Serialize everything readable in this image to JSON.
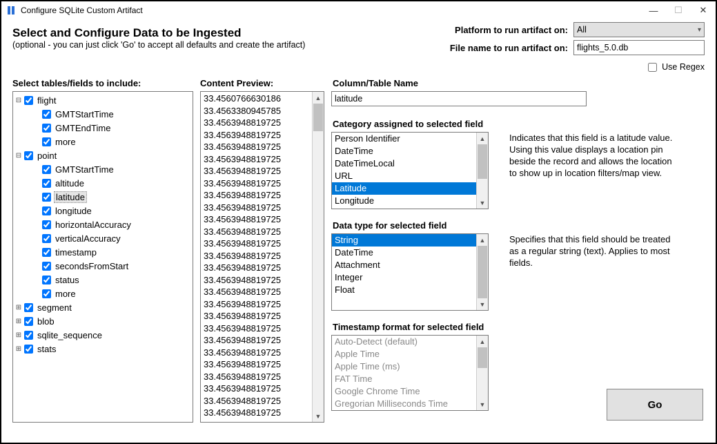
{
  "window": {
    "title": "Configure SQLite Custom Artifact"
  },
  "header": {
    "title": "Select and Configure Data to be Ingested",
    "subtitle": "(optional - you can just click 'Go' to accept all defaults and create the artifact)",
    "platform_label": "Platform to run artifact on:",
    "filename_label": "File name to run artifact on:",
    "platform_value": "All",
    "filename_value": "flights_5.0.db",
    "use_regex_label": "Use Regex"
  },
  "labels": {
    "tree": "Select tables/fields to include:",
    "preview": "Content Preview:",
    "column_name": "Column/Table Name",
    "category": "Category assigned to selected field",
    "datatype": "Data type for selected field",
    "timestamp": "Timestamp format for selected field",
    "go": "Go"
  },
  "column_name_value": "latitude",
  "tree": [
    {
      "toggle": "⊟",
      "indent": 0,
      "label": "flight"
    },
    {
      "toggle": "",
      "indent": 1,
      "label": "GMTStartTime"
    },
    {
      "toggle": "",
      "indent": 1,
      "label": "GMTEndTime"
    },
    {
      "toggle": "",
      "indent": 1,
      "label": "more"
    },
    {
      "toggle": "⊟",
      "indent": 0,
      "label": "point"
    },
    {
      "toggle": "",
      "indent": 1,
      "label": "GMTStartTime"
    },
    {
      "toggle": "",
      "indent": 1,
      "label": "altitude"
    },
    {
      "toggle": "",
      "indent": 1,
      "label": "latitude",
      "selected": true
    },
    {
      "toggle": "",
      "indent": 1,
      "label": "longitude"
    },
    {
      "toggle": "",
      "indent": 1,
      "label": "horizontalAccuracy"
    },
    {
      "toggle": "",
      "indent": 1,
      "label": "verticalAccuracy"
    },
    {
      "toggle": "",
      "indent": 1,
      "label": "timestamp"
    },
    {
      "toggle": "",
      "indent": 1,
      "label": "secondsFromStart"
    },
    {
      "toggle": "",
      "indent": 1,
      "label": "status"
    },
    {
      "toggle": "",
      "indent": 1,
      "label": "more"
    },
    {
      "toggle": "⊞",
      "indent": 0,
      "label": "segment"
    },
    {
      "toggle": "⊞",
      "indent": 0,
      "label": "blob"
    },
    {
      "toggle": "⊞",
      "indent": 0,
      "label": "sqlite_sequence"
    },
    {
      "toggle": "⊞",
      "indent": 0,
      "label": "stats"
    }
  ],
  "preview": [
    "33.4560766630186",
    "33.4563380945785",
    "33.4563948819725",
    "33.4563948819725",
    "33.4563948819725",
    "33.4563948819725",
    "33.4563948819725",
    "33.4563948819725",
    "33.4563948819725",
    "33.4563948819725",
    "33.4563948819725",
    "33.4563948819725",
    "33.4563948819725",
    "33.4563948819725",
    "33.4563948819725",
    "33.4563948819725",
    "33.4563948819725",
    "33.4563948819725",
    "33.4563948819725",
    "33.4563948819725",
    "33.4563948819725",
    "33.4563948819725",
    "33.4563948819725",
    "33.4563948819725",
    "33.4563948819725",
    "33.4563948819725",
    "33.4563948819725"
  ],
  "category": {
    "items": [
      "Person Identifier",
      "DateTime",
      "DateTimeLocal",
      "URL",
      "Latitude",
      "Longitude"
    ],
    "selected": "Latitude",
    "description": "Indicates that this field is a latitude value. Using this value displays a location pin beside the record and allows the location to show up in location filters/map view."
  },
  "datatype": {
    "items": [
      "String",
      "DateTime",
      "Attachment",
      "Integer",
      "Float"
    ],
    "selected": "String",
    "description": "Specifies that this field should be treated as a regular string (text). Applies to most fields."
  },
  "timestamp": {
    "items": [
      "Auto-Detect (default)",
      "Apple Time",
      "Apple Time (ms)",
      "FAT Time",
      "Google Chrome Time",
      "Gregorian Milliseconds Time"
    ]
  }
}
